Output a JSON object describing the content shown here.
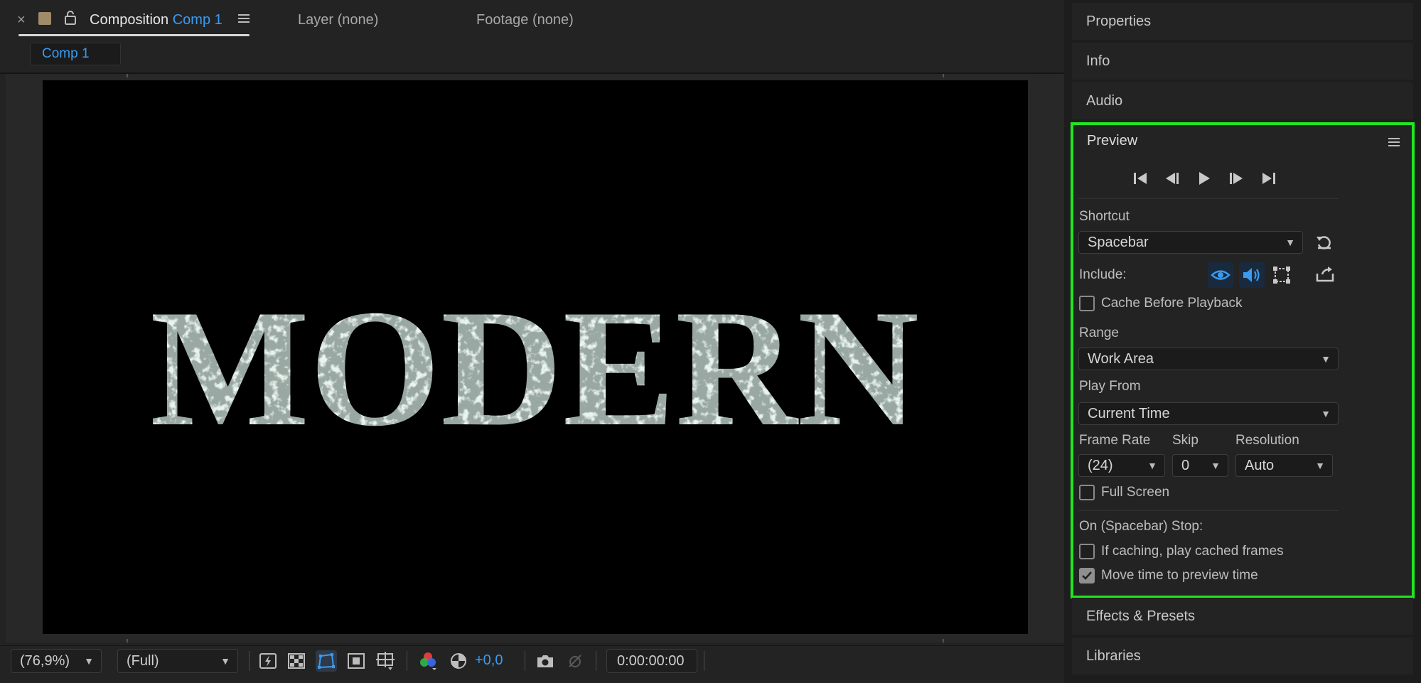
{
  "composition_tabs": {
    "close_glyph": "×",
    "active_tab_prefix": "Composition",
    "active_tab_name": "Comp 1",
    "layer_tab": "Layer (none)",
    "footage_tab": "Footage (none)",
    "subtab": "Comp 1"
  },
  "canvas": {
    "text": "MODERN",
    "text_color": "#9aa8a3",
    "background": "#000000"
  },
  "viewer_toolbar": {
    "zoom": "(76,9%)",
    "resolution": "(Full)",
    "exposure": "+0,0",
    "timecode": "0:00:00:00"
  },
  "right_panels": {
    "properties": "Properties",
    "info": "Info",
    "audio": "Audio",
    "effects_presets": "Effects & Presets",
    "libraries": "Libraries"
  },
  "preview": {
    "title": "Preview",
    "shortcut_label": "Shortcut",
    "shortcut_value": "Spacebar",
    "include_label": "Include:",
    "cache_before_playback": "Cache Before Playback",
    "range_label": "Range",
    "range_value": "Work Area",
    "play_from_label": "Play From",
    "play_from_value": "Current Time",
    "frame_rate_label": "Frame Rate",
    "frame_rate_value": "(24)",
    "skip_label": "Skip",
    "skip_value": "0",
    "resolution_label": "Resolution",
    "resolution_value": "Auto",
    "full_screen": "Full Screen",
    "stop_label": "On (Spacebar) Stop:",
    "if_caching": "If caching, play cached frames",
    "move_time": "Move time to preview time",
    "move_time_checked": true,
    "accent": "#3a9bf0",
    "highlight": "#22e622"
  }
}
